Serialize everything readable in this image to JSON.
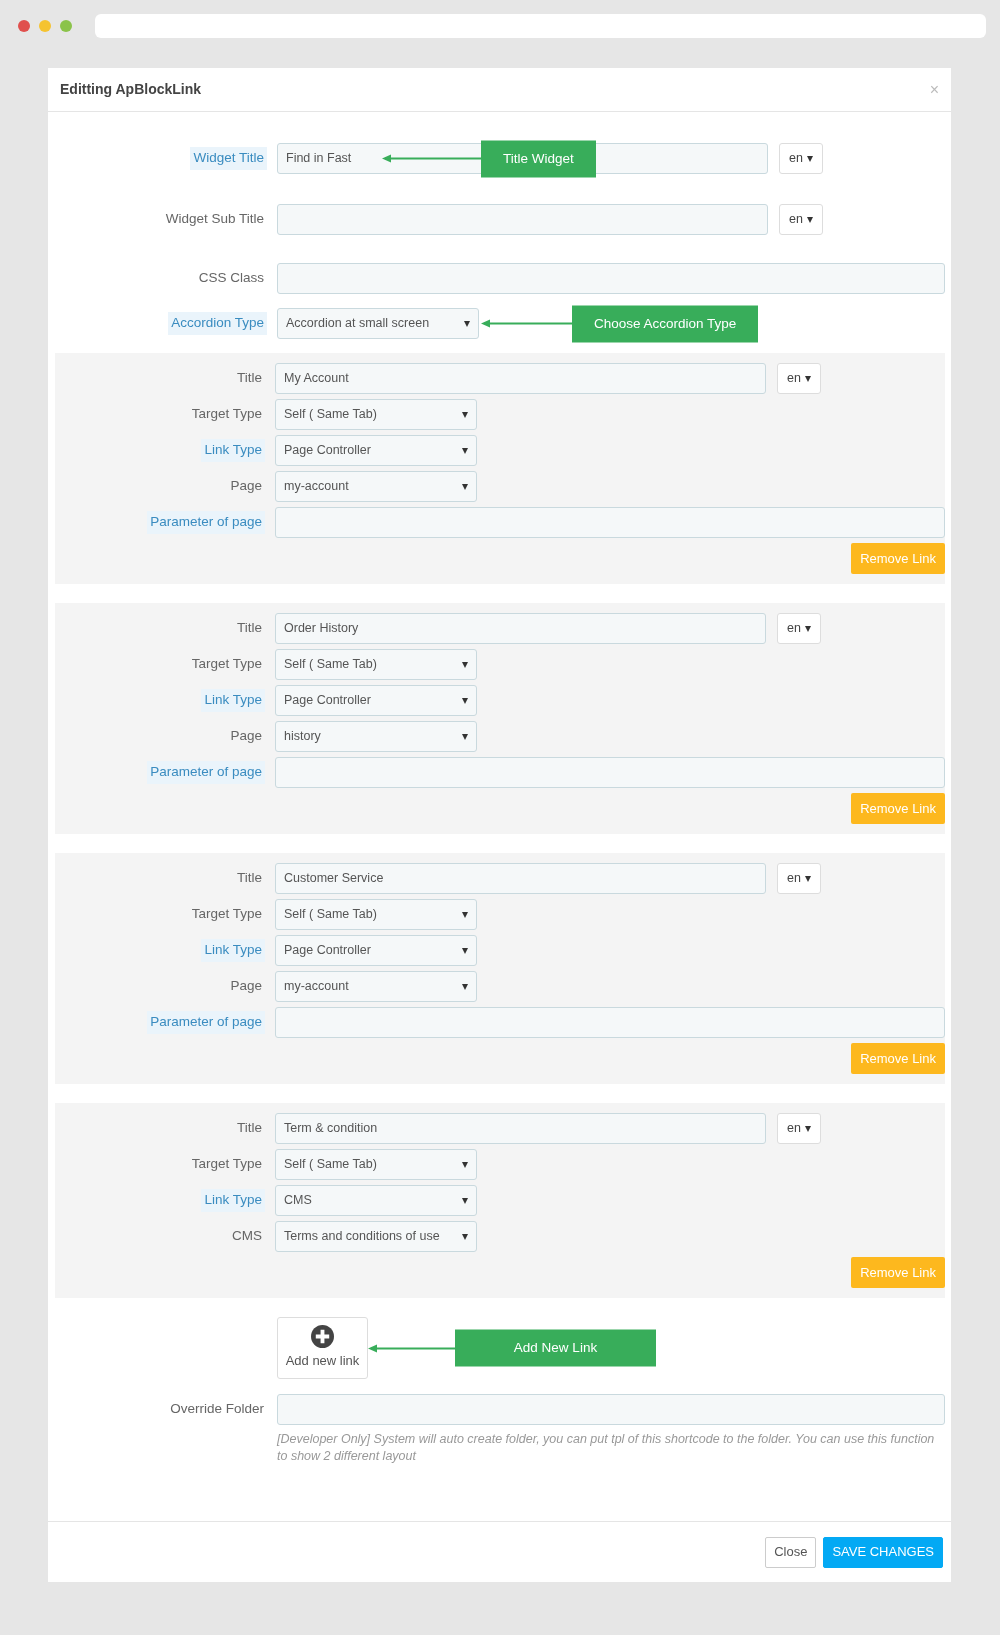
{
  "modal": {
    "title": "Editting ApBlockLink",
    "close": "×"
  },
  "fields": [
    {
      "label": "Widget Title",
      "highlighted": true,
      "kind": "text",
      "value": "Find in Fast",
      "lang": "en",
      "callout": "Title Widget"
    },
    {
      "label": "Widget Sub Title",
      "highlighted": false,
      "kind": "text",
      "lang": "en"
    },
    {
      "label": "CSS Class",
      "highlighted": false,
      "kind": "text"
    },
    {
      "label": "Accordion Type",
      "highlighted": true,
      "kind": "select",
      "value": "Accordion at small screen",
      "callout": "Choose Accordion Type"
    }
  ],
  "links": [
    {
      "fields": [
        {
          "label": "Title",
          "highlighted": false,
          "kind": "text",
          "value": "My Account",
          "lang": "en"
        },
        {
          "label": "Target Type",
          "highlighted": false,
          "kind": "select",
          "value": "Self ( Same Tab)"
        },
        {
          "label": "Link Type",
          "highlighted": true,
          "kind": "select",
          "value": "Page Controller"
        },
        {
          "label": "Page",
          "highlighted": false,
          "kind": "select",
          "value": "my-account"
        },
        {
          "label": "Parameter of page",
          "highlighted": true,
          "kind": "wide"
        }
      ],
      "remove_button": "Remove Link"
    },
    {
      "fields": [
        {
          "label": "Title",
          "highlighted": false,
          "kind": "text",
          "value": "Order History",
          "lang": "en"
        },
        {
          "label": "Target Type",
          "highlighted": false,
          "kind": "select",
          "value": "Self ( Same Tab)"
        },
        {
          "label": "Link Type",
          "highlighted": true,
          "kind": "select",
          "value": "Page Controller"
        },
        {
          "label": "Page",
          "highlighted": false,
          "kind": "select",
          "value": "history"
        },
        {
          "label": "Parameter of page",
          "highlighted": true,
          "kind": "wide"
        }
      ],
      "remove_button": "Remove Link"
    },
    {
      "fields": [
        {
          "label": "Title",
          "highlighted": false,
          "kind": "text",
          "value": "Customer Service",
          "lang": "en"
        },
        {
          "label": "Target Type",
          "highlighted": false,
          "kind": "select",
          "value": "Self ( Same Tab)"
        },
        {
          "label": "Link Type",
          "highlighted": true,
          "kind": "select",
          "value": "Page Controller"
        },
        {
          "label": "Page",
          "highlighted": false,
          "kind": "select",
          "value": "my-account"
        },
        {
          "label": "Parameter of page",
          "highlighted": true,
          "kind": "wide"
        }
      ],
      "remove_button": "Remove Link"
    },
    {
      "fields": [
        {
          "label": "Title",
          "highlighted": false,
          "kind": "text",
          "value": "Term & condition",
          "lang": "en"
        },
        {
          "label": "Target Type",
          "highlighted": false,
          "kind": "select",
          "value": "Self ( Same Tab)"
        },
        {
          "label": "Link Type",
          "highlighted": true,
          "kind": "select",
          "value": "CMS"
        },
        {
          "label": "CMS",
          "highlighted": false,
          "kind": "select",
          "value": "Terms and conditions of use"
        }
      ],
      "remove_button": "Remove Link"
    }
  ],
  "add_link": {
    "label": "Add new link",
    "callout": "Add New Link"
  },
  "override_folder": {
    "label": "Override Folder",
    "help": "[Developer Only] System will auto create folder, you can put tpl of this shortcode to the folder. You can use this function to show 2 different layout"
  },
  "footer": {
    "buttons": [
      {
        "label": "Close",
        "kind": "default"
      },
      {
        "label": "SAVE CHANGES",
        "kind": "primary"
      }
    ]
  }
}
